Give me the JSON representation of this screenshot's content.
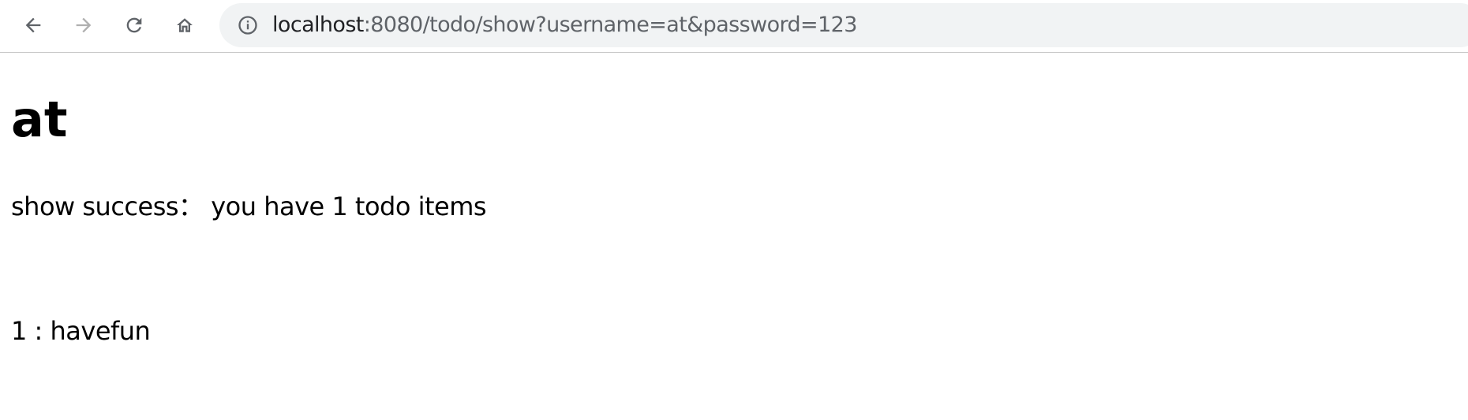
{
  "browser": {
    "url_host": "localhost",
    "url_rest": ":8080/todo/show?username=at&password=123",
    "icons": {
      "back": "back-arrow-icon",
      "forward": "forward-arrow-icon",
      "reload": "reload-icon",
      "home": "home-icon",
      "info": "info-icon"
    },
    "colors": {
      "omnibox_bg": "#f1f3f4",
      "url_host": "#202124",
      "url_rest": "#5f6368",
      "forward_disabled": "#b0b0b0"
    }
  },
  "page": {
    "heading": "at",
    "status": "show success： you have 1 todo items",
    "items": [
      {
        "index": "1",
        "separator": " : ",
        "text": "havefun"
      }
    ]
  }
}
